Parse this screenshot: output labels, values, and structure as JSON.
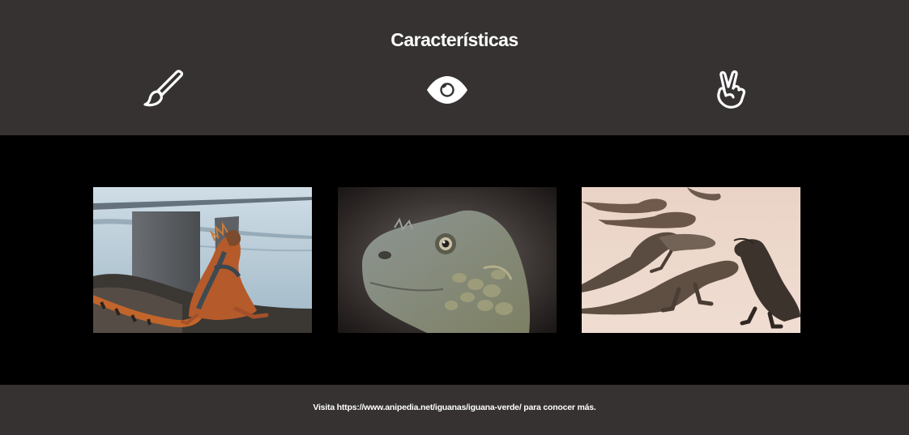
{
  "features": {
    "title": "Características",
    "icons": [
      "paintbrush-icon",
      "eye-icon",
      "peace-hand-icon"
    ]
  },
  "gallery": {
    "photos": [
      "iguana-on-shore-photo",
      "iguana-head-closeup-photo",
      "iguana-group-on-sand-photo"
    ]
  },
  "footer": {
    "text": "Visita https://www.anipedia.net/iguanas/iguana-verde/ para conocer más."
  },
  "colors": {
    "section_bg": "#363232",
    "gallery_bg": "#000000",
    "text": "#ffffff"
  }
}
